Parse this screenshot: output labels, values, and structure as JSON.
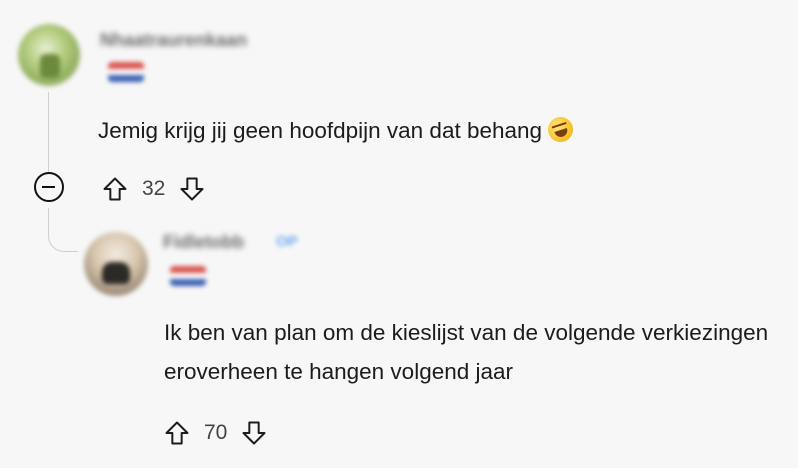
{
  "comments": [
    {
      "username": "Nhaatraurenkaan",
      "flair": "NL",
      "text": "Jemig krijg jij geen hoofdpijn van dat behang",
      "emoji": "rolling-on-floor-laughing",
      "score": "32"
    },
    {
      "username": "Fidletobb",
      "op_badge": "OP",
      "flair": "NL",
      "text": "Ik ben van plan om de kieslijst van de volgende verkiezingen eroverheen te hangen volgend jaar",
      "score": "70"
    }
  ],
  "icons": {
    "upvote": "arrow-up-outline-icon",
    "downvote": "arrow-down-outline-icon",
    "collapse": "minus-circle-icon"
  },
  "colors": {
    "background": "#f7f7f7",
    "text": "#1c1c1c",
    "thread_line": "#cfcfcf",
    "op_badge": "#6aa8f0",
    "flag_red": "#d9534f",
    "flag_white": "#ffffff",
    "flag_blue": "#3a5fb0"
  }
}
